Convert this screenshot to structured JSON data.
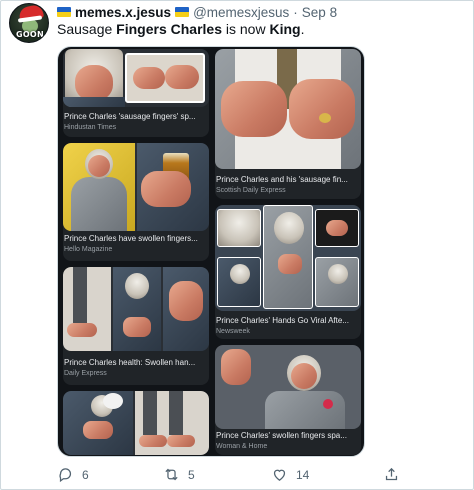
{
  "tweet": {
    "author": {
      "display_name": "memes.x.jesus",
      "handle": "@memesxjesus",
      "separator": "·",
      "date": "Sep 8",
      "avatar_text": "GOON"
    },
    "text": {
      "part1": "Sausage ",
      "bold1": "Fingers Charles",
      "part2": " is now ",
      "bold2": "King",
      "part3": "."
    },
    "media": {
      "cards": [
        {
          "title": "Prince Charles 'sausage fingers' sp...",
          "source": "Hindustan Times"
        },
        {
          "title": "Prince Charles and his 'sausage fin...",
          "source": "Scottish Daily Express"
        },
        {
          "title": "Prince Charles have swollen fingers...",
          "source": "Hello Magazine"
        },
        {
          "title": "Prince Charles' Hands Go Viral Afte...",
          "source": "Newsweek"
        },
        {
          "title": "Prince Charles health: Swollen han...",
          "source": "Daily Express"
        },
        {
          "title": "Prince Charles' swollen fingers spa...",
          "source": "Woman & Home"
        }
      ]
    },
    "actions": {
      "reply_count": "6",
      "retweet_count": "5",
      "like_count": "14"
    },
    "icons": {
      "reply": "reply-icon",
      "retweet": "retweet-icon",
      "like": "heart-icon",
      "share": "share-icon"
    },
    "colors": {
      "text": "#0f1419",
      "secondary": "#536471",
      "media_bg": "#111418",
      "flag_blue": "#1f63c6",
      "flag_yellow": "#f5cf18"
    }
  }
}
